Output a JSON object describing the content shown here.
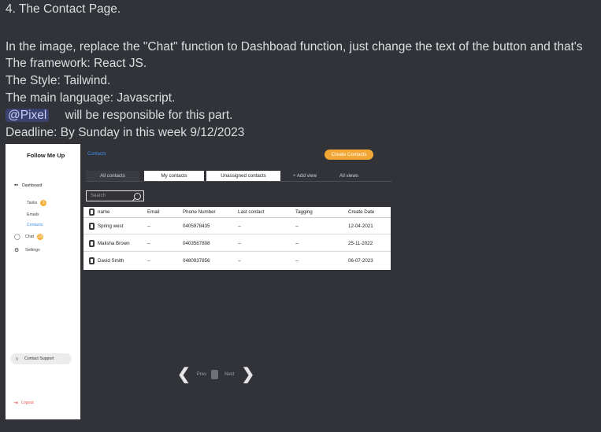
{
  "message": {
    "line1": "4. The Contact Page.",
    "line2": "In the image, replace the \"Chat\" function to Dashboad function, just change the text of the button and that's",
    "line3": "The framework: React JS.",
    "line4": "The Style: Tailwind.",
    "line5": "The main language: Javascript.",
    "mention": "@Pixel",
    "line6_rest": "will be responsible for this part.",
    "line7": "Deadline: By Sunday in this week 9/12/2023"
  },
  "app": {
    "brand": "Follow Me Up",
    "nav": {
      "dashboard": "Dashboard",
      "tasks": "Tasks",
      "tasks_badge": "3",
      "emails": "Emails",
      "contacts": "Contacts",
      "chat": "Chat",
      "chat_badge": "19",
      "settings": "Settings"
    },
    "support": "Contact Support",
    "logout": "Logout",
    "breadcrumb": "Contacts",
    "create_button": "Create Contacts",
    "tabs": {
      "all": "All contacts",
      "mine": "My contacts",
      "unassigned": "Unassigned contacts",
      "add_view": "+ Add view",
      "all_views": "All views"
    },
    "search_placeholder": "Search",
    "table": {
      "headers": [
        "name",
        "Email",
        "Phone Number",
        "Last contact",
        "Tagging",
        "Create Date"
      ],
      "rows": [
        [
          "Spring west",
          "--",
          "0405978435",
          "--",
          "--",
          "12-04-2021"
        ],
        [
          "Malisha Brown",
          "--",
          "0403567898",
          "--",
          "--",
          "25-11-2022"
        ],
        [
          "David Smith",
          "--",
          "0480937856",
          "--",
          "--",
          "06-07-2023"
        ]
      ]
    },
    "pager": {
      "prev": "Prev",
      "next": "Next"
    }
  },
  "colors": {
    "accent": "#f2a634",
    "link": "#3a8ef0",
    "logout": "#e3584f",
    "mention_bg": "#3c4270"
  }
}
